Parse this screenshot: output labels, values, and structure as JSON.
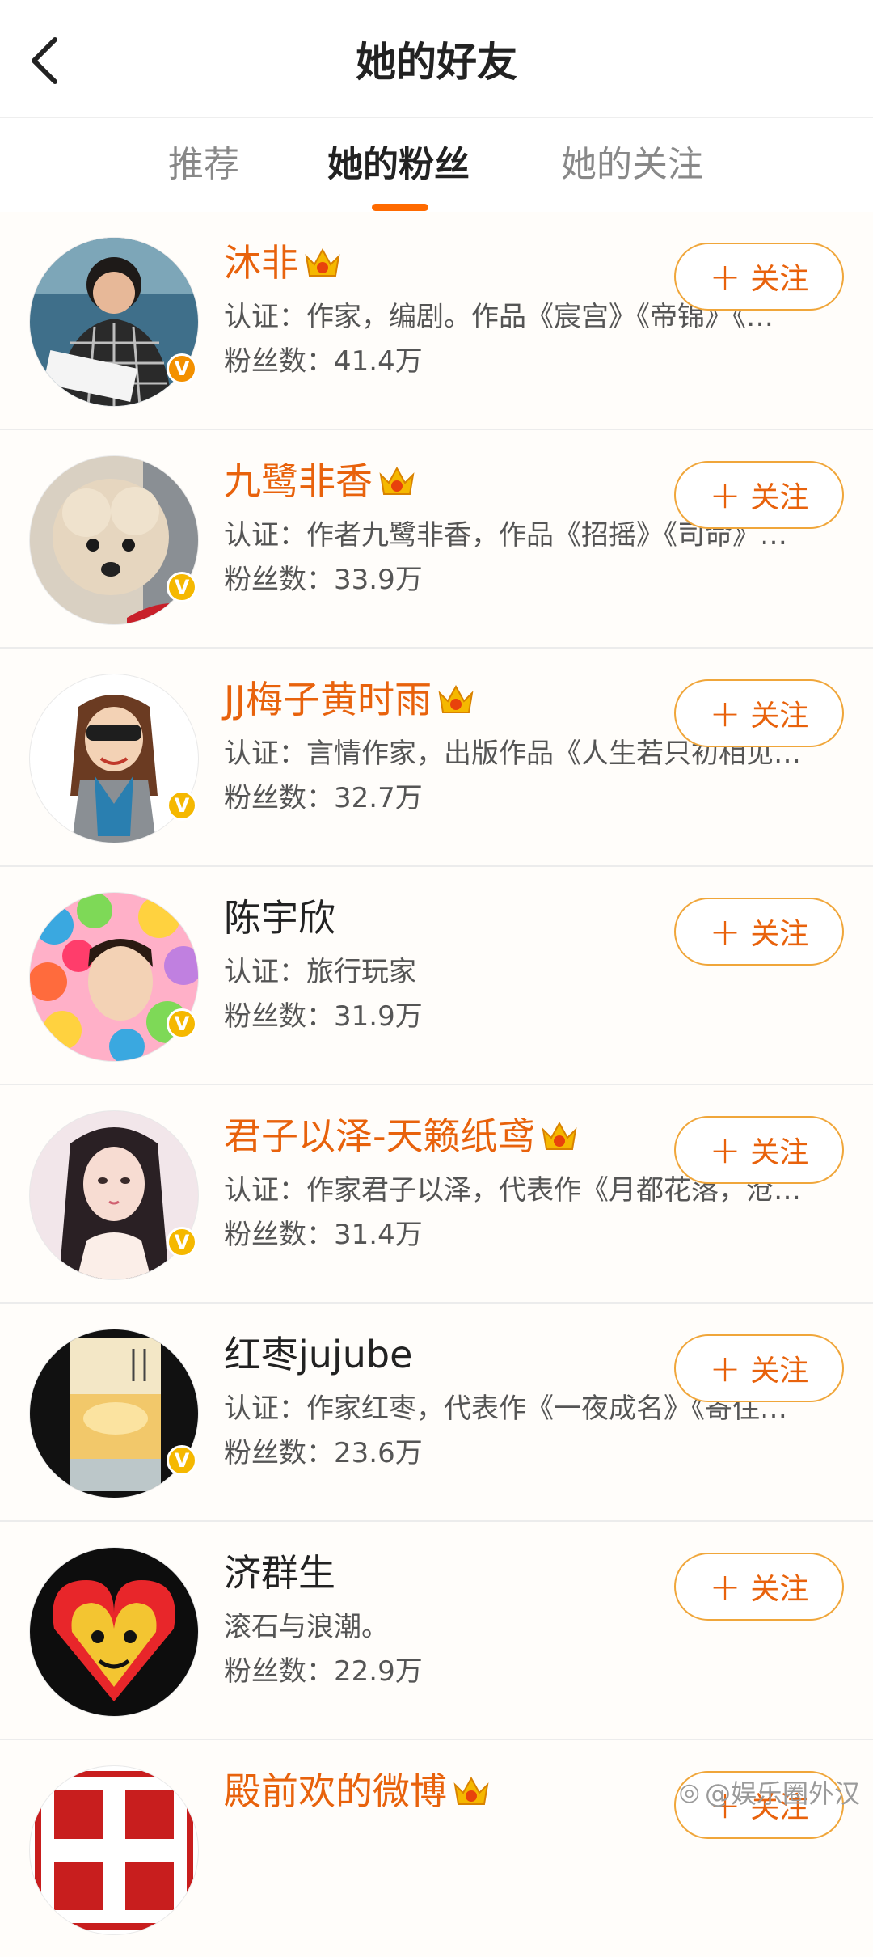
{
  "header": {
    "title": "她的好友"
  },
  "tabs": [
    {
      "label": "推荐"
    },
    {
      "label": "她的粉丝"
    },
    {
      "label": "她的关注"
    }
  ],
  "colors": {
    "accent": "#e8620c",
    "indicator": "#ff6a00",
    "border": "#f0a63a"
  },
  "users": [
    {
      "name": "沐非",
      "vip": true,
      "desc": "认证：作家，编剧。作品《宸宫》《帝锦》《…",
      "fans": "粉丝数：41.4万",
      "badge": "orange",
      "follow": "关注"
    },
    {
      "name": "九鹭非香",
      "vip": true,
      "desc": "认证：作者九鹭非香，作品《招摇》《司命》…",
      "fans": "粉丝数：33.9万",
      "badge": "yellow",
      "follow": "关注"
    },
    {
      "name": "JJ梅子黄时雨",
      "vip": true,
      "desc": "认证：言情作家，出版作品《人生若只初相见…",
      "fans": "粉丝数：32.7万",
      "badge": "yellow",
      "follow": "关注"
    },
    {
      "name": "陈宇欣",
      "vip": false,
      "desc": "认证：旅行玩家",
      "fans": "粉丝数：31.9万",
      "badge": "yellow",
      "follow": "关注"
    },
    {
      "name": "君子以泽-天籁纸鸢",
      "vip": true,
      "desc": "认证：作家君子以泽，代表作《月都花落，沧…",
      "fans": "粉丝数：31.4万",
      "badge": "yellow",
      "follow": "关注"
    },
    {
      "name": "红枣jujube",
      "vip": false,
      "desc": "认证：作家红枣，代表作《一夜成名》《寄住…",
      "fans": "粉丝数：23.6万",
      "badge": "yellow",
      "follow": "关注"
    },
    {
      "name": "济群生",
      "vip": false,
      "desc": "滚石与浪潮。",
      "fans": "粉丝数：22.9万",
      "badge": "",
      "follow": "关注"
    },
    {
      "name": "殿前欢的微博",
      "vip": true,
      "desc": "",
      "fans": "",
      "badge": "",
      "follow": "关注"
    }
  ],
  "watermark": {
    "text": "@娱乐圈外汉"
  }
}
